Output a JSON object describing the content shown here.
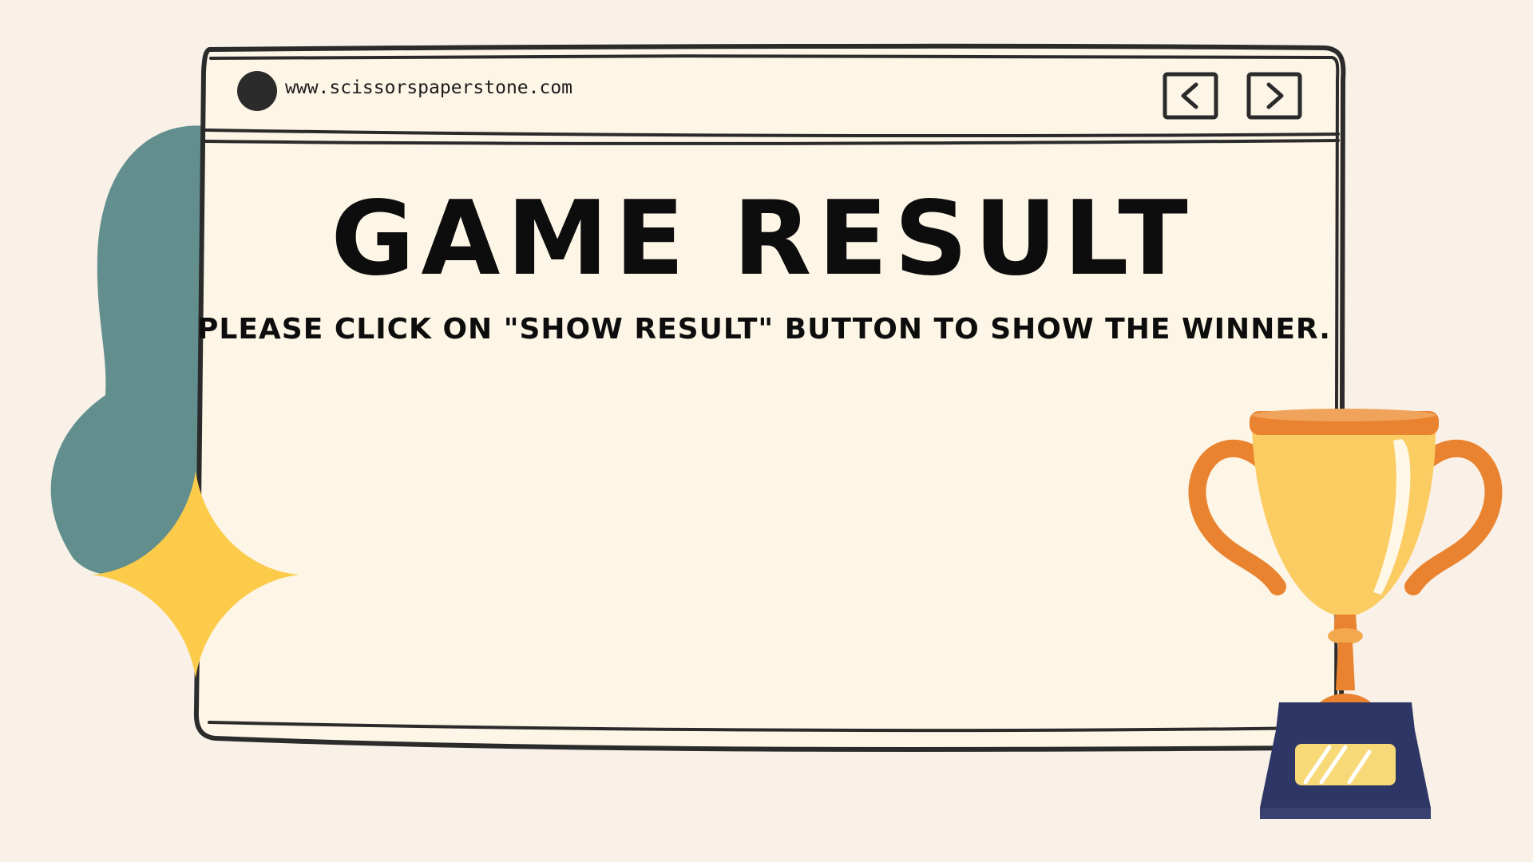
{
  "browser": {
    "url": "www.scissorspaperstone.com",
    "back_icon": "chevron-left-icon",
    "forward_icon": "chevron-right-icon"
  },
  "main": {
    "title": "GAME RESULT",
    "instruction": "PLEASE CLICK ON \"SHOW RESULT\" BUTTON TO SHOW THE WINNER."
  },
  "colors": {
    "background": "#f9f1e8",
    "window": "#fdf5e6",
    "outline": "#2b2b2b",
    "teal_blob": "#628f8e",
    "sparkle": "#fccb4a",
    "trophy_gold": "#fbcc62",
    "trophy_orange": "#e9832f",
    "trophy_base": "#2d3664"
  }
}
